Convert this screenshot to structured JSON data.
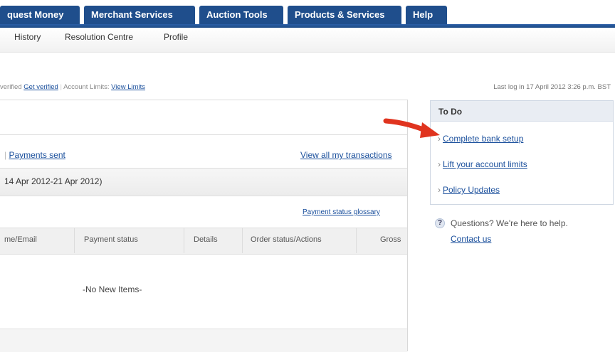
{
  "tabs": [
    {
      "label": "quest Money"
    },
    {
      "label": "Merchant Services"
    },
    {
      "label": "Auction Tools"
    },
    {
      "label": "Products & Services"
    },
    {
      "label": "Help"
    }
  ],
  "subnav": [
    "History",
    "Resolution Centre",
    "Profile"
  ],
  "status": {
    "verified_fragment": "verified",
    "get_verified": "Get verified",
    "limits_label": "Account Limits:",
    "view_limits": "View Limits",
    "last_login": "Last log in 17 April 2012 3:26 p.m. BST"
  },
  "transactions": {
    "payments_sent": "Payments sent",
    "view_all": "View all my transactions",
    "range": "14 Apr 2012-21 Apr 2012)",
    "glossary": "Payment status glossary",
    "columns": [
      "me/Email",
      "Payment status",
      "Details",
      "Order status/Actions",
      "Gross"
    ],
    "empty_text": "-No New Items-"
  },
  "todo": {
    "title": "To Do",
    "items": [
      "Complete bank setup",
      "Lift your account limits",
      "Policy Updates"
    ]
  },
  "help": {
    "icon": "?",
    "text": "Questions? We're here to help.",
    "contact": "Contact us"
  },
  "colors": {
    "tab_blue": "#1f4e8c",
    "link_blue": "#1a4f9c",
    "arrow_red": "#e0341f"
  }
}
